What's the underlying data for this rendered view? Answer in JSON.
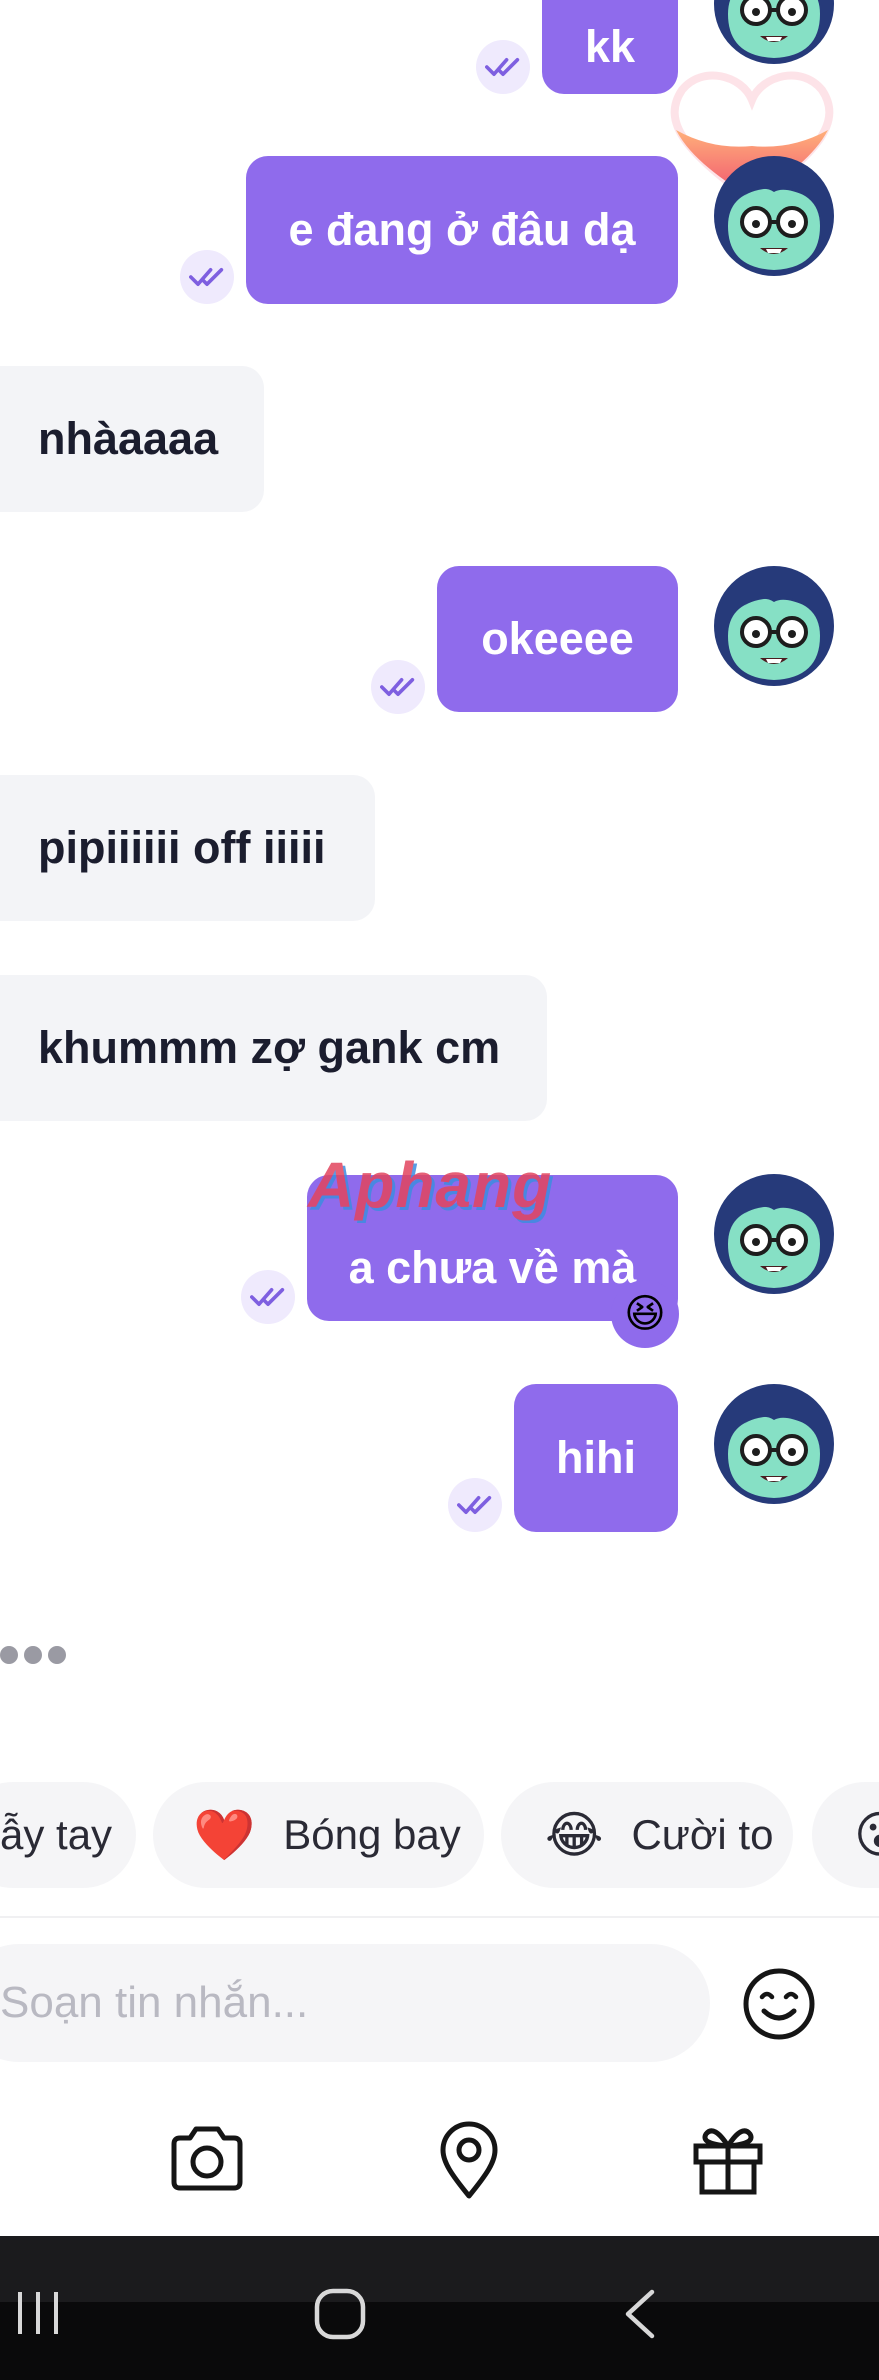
{
  "messages": [
    {
      "side": "out",
      "text": "kk"
    },
    {
      "side": "out",
      "text": "e đang ở đâu dạ"
    },
    {
      "side": "in",
      "text": "nhàaaaa"
    },
    {
      "side": "out",
      "text": "okeeee"
    },
    {
      "side": "in",
      "text": "pipiiiiii off iiiii"
    },
    {
      "side": "in",
      "text": "khummm zợ gank cm"
    },
    {
      "side": "out",
      "text": "a chưa về mà",
      "reaction": "😆"
    },
    {
      "side": "out",
      "text": "hihi"
    }
  ],
  "watermark": "Aphang",
  "quick_reactions": [
    {
      "emoji": "",
      "label": "ẫy tay"
    },
    {
      "emoji": "❤️",
      "label": "Bóng bay"
    },
    {
      "emoji": "😂",
      "label": "Cười to"
    },
    {
      "emoji": "😮",
      "label": ""
    }
  ],
  "composer": {
    "placeholder": "Soạn tin nhắn..."
  },
  "toolbar": {
    "camera_icon": "camera-icon",
    "location_icon": "location-pin-icon",
    "gift_icon": "gift-icon"
  },
  "colors": {
    "outgoing_bubble": "#8f6bec",
    "incoming_bubble": "#f3f4f7",
    "avatar_face": "#86e0c5",
    "avatar_hair": "#263a7a"
  }
}
